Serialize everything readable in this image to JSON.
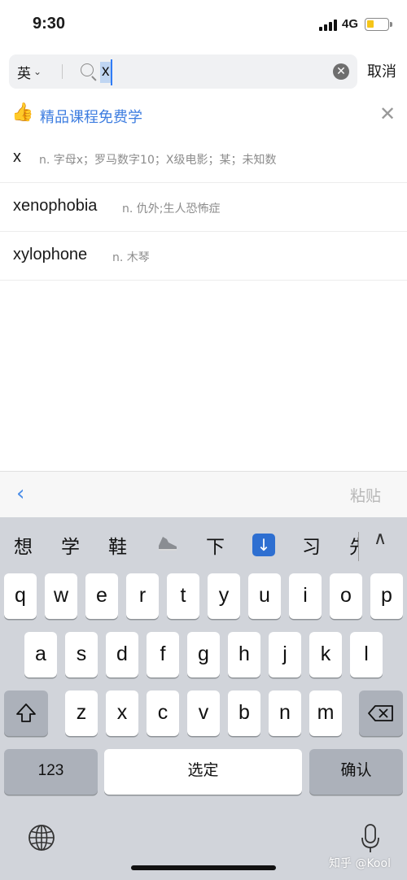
{
  "status": {
    "time": "9:30",
    "network": "4G"
  },
  "search": {
    "lang": "英",
    "query": "x",
    "cancel": "取消"
  },
  "promo": {
    "text": "精品课程免费学"
  },
  "suggestions": [
    {
      "word": "x",
      "def": "n. 字母x；罗马数字10；X级电影；某；未知数"
    },
    {
      "word": "xenophobia",
      "def": "n. 仇外;生人恐怖症"
    },
    {
      "word": "xylophone",
      "def": "n. 木琴"
    }
  ],
  "accessory": {
    "paste": "粘贴"
  },
  "keyboard": {
    "candidates": [
      "想",
      "学",
      "鞋",
      "下",
      "习",
      "先"
    ],
    "row1": [
      "q",
      "w",
      "e",
      "r",
      "t",
      "y",
      "u",
      "i",
      "o",
      "p"
    ],
    "row2": [
      "a",
      "s",
      "d",
      "f",
      "g",
      "h",
      "j",
      "k",
      "l"
    ],
    "row3": [
      "z",
      "x",
      "c",
      "v",
      "b",
      "n",
      "m"
    ],
    "numbers": "123",
    "space": "选定",
    "confirm": "确认"
  },
  "watermark": "知乎 @Kool",
  "colors": {
    "accent": "#3d7de0",
    "keyboard_bg": "#d1d4da",
    "key_dark": "#acb1ba",
    "thumb": "#f5a623"
  },
  "icons": [
    "search-icon",
    "clear-icon",
    "thumbs-up-icon",
    "close-icon",
    "chevron-left-icon",
    "shoe-icon",
    "down-arrow-icon",
    "chevron-up-icon",
    "shift-icon",
    "backspace-icon",
    "globe-icon",
    "microphone-icon"
  ]
}
